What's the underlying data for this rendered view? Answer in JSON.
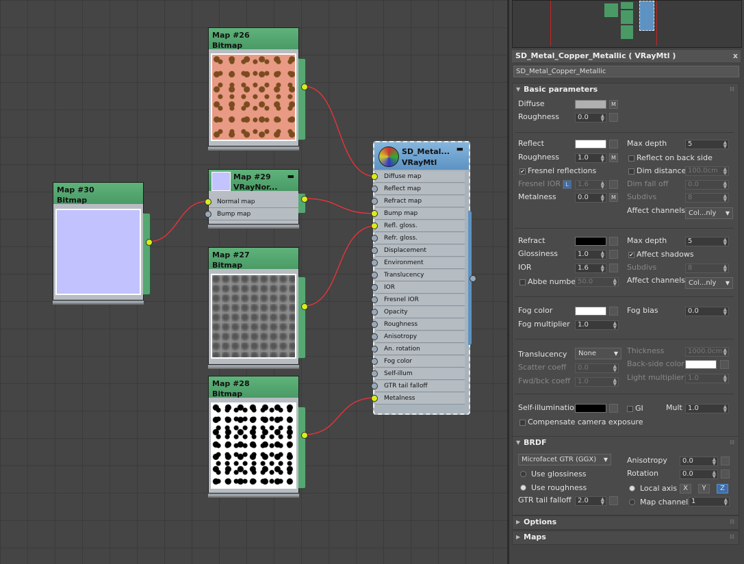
{
  "graph": {
    "map26": {
      "title": "Map #26",
      "type": "Bitmap"
    },
    "map29": {
      "title": "Map #29",
      "type": "VRayNor...",
      "slots": [
        "Normal map",
        "Bump map"
      ]
    },
    "map30": {
      "title": "Map #30",
      "type": "Bitmap"
    },
    "map27": {
      "title": "Map #27",
      "type": "Bitmap"
    },
    "map28": {
      "title": "Map #28",
      "type": "Bitmap"
    },
    "vraymtl": {
      "title": "SD_Metal...",
      "type": "VRayMtl",
      "slots": [
        "Diffuse map",
        "Reflect map",
        "Refract map",
        "Bump map",
        "Refl. gloss.",
        "Refr. gloss.",
        "Displacement",
        "Environment",
        "Translucency",
        "IOR",
        "Fresnel IOR",
        "Opacity",
        "Roughness",
        "Anisotropy",
        "An. rotation",
        "Fog color",
        "Self-illum",
        "GTR tail falloff",
        "Metalness"
      ]
    }
  },
  "panel": {
    "title": "SD_Metal_Copper_Metallic  ( VRayMtl )",
    "close": "x",
    "name": "SD_Metal_Copper_Metallic",
    "basic": {
      "header": "Basic parameters",
      "diffuse": "Diffuse",
      "roughness": "Roughness",
      "diffuse_roughness_val": "0.0",
      "m": "M",
      "reflect": "Reflect",
      "refl_roughness": "1.0",
      "fresnel": "Fresnel reflections",
      "fresnel_ior": "Fresnel IOR",
      "l": "L",
      "fresnel_ior_val": "1.6",
      "metalness": "Metalness",
      "metalness_val": "0.0",
      "max_depth": "Max depth",
      "refl_max_depth_val": "5",
      "reflect_back": "Reflect on back side",
      "dim_distance": "Dim distance",
      "dim_distance_val": "100.0cm",
      "dim_falloff": "Dim fall off",
      "dim_falloff_val": "0.0",
      "subdivs": "Subdivs",
      "subdivs_val": "8",
      "affect_channels": "Affect channels",
      "affect_val": "Col...nly",
      "refract": "Refract",
      "glossiness": "Glossiness",
      "gloss_val": "1.0",
      "ior": "IOR",
      "ior_val": "1.6",
      "abbe": "Abbe number",
      "abbe_val": "50.0",
      "refr_max_depth_val": "5",
      "affect_shadows": "Affect shadows",
      "fog_color": "Fog color",
      "fog_mult": "Fog multiplier",
      "fog_mult_val": "1.0",
      "fog_bias": "Fog bias",
      "fog_bias_val": "0.0",
      "translucency": "Translucency",
      "transl_val": "None",
      "scatter": "Scatter coeff",
      "scatter_val": "0.0",
      "fwd": "Fwd/bck coeff",
      "fwd_val": "1.0",
      "thickness": "Thickness",
      "thickness_val": "1000.0cm",
      "backside": "Back-side color",
      "light_mult": "Light multiplier",
      "light_mult_val": "1.0",
      "selfillum": "Self-illumination",
      "gi": "GI",
      "mult": "Mult",
      "mult_val": "1.0",
      "compensate": "Compensate camera exposure",
      "check": "✔"
    },
    "brdf": {
      "header": "BRDF",
      "type": "Microfacet GTR (GGX)",
      "use_gloss": "Use glossiness",
      "use_rough": "Use roughness",
      "gtr": "GTR tail falloff",
      "gtr_val": "2.0",
      "aniso": "Anisotropy",
      "aniso_val": "0.0",
      "rotation": "Rotation",
      "rotation_val": "0.0",
      "local_axis": "Local axis",
      "map_channel": "Map channel",
      "map_channel_val": "1",
      "x": "X",
      "y": "Y",
      "z": "Z"
    },
    "options": "Options",
    "maps": "Maps"
  },
  "colors": {
    "node_header": "#4a9a66",
    "wire": "#e0343a",
    "socket": "#d8ee1a",
    "vray_header": "#5d92c2"
  }
}
